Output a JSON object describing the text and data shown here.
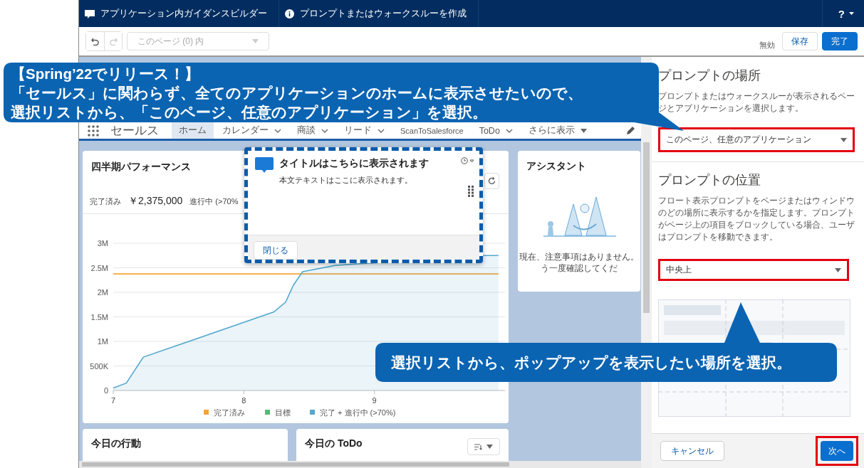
{
  "top_bar": {
    "tabs": [
      {
        "label": "アプリケーション内ガイダンスビルダー"
      },
      {
        "label": "プロンプトまたはウォークスルーを作成"
      }
    ],
    "help": "?"
  },
  "toolbar": {
    "page_select": {
      "value": "このページ (0) 内",
      "disabled": true
    },
    "status": "無効",
    "buttons": [
      {
        "label": "保存",
        "kind": "neutral"
      },
      {
        "label": "完了",
        "kind": "brand"
      }
    ]
  },
  "app_nav": {
    "app_name": "セールス",
    "tabs": [
      {
        "label": "ホーム",
        "selected": true,
        "kind": "tab",
        "menu": false
      },
      {
        "label": "カレンダー",
        "selected": false,
        "kind": "tab",
        "menu": true
      },
      {
        "label": "商談",
        "selected": false,
        "kind": "tab",
        "menu": true
      },
      {
        "label": "リード",
        "selected": false,
        "kind": "tab",
        "menu": true
      },
      {
        "label": "ScanToSalesforce",
        "selected": false,
        "kind": "tab",
        "menu": false
      },
      {
        "label": "ToDo",
        "selected": false,
        "kind": "tab",
        "menu": true
      },
      {
        "label": "さらに表示",
        "selected": false,
        "kind": "more",
        "menu": true
      }
    ]
  },
  "dashboard": {
    "performance": {
      "title": "四半期パフォーマンス",
      "closed_label": "完了済み",
      "closed_value": "￥2,375,000",
      "open_label": "進行中 (>70%",
      "chart_data": {
        "type": "line",
        "grid": true,
        "legend": true,
        "x": [
          7,
          7.1,
          7.23,
          8.23,
          8.32,
          8.38,
          8.45,
          8.7,
          9.85,
          9.95
        ],
        "xlim": [
          7,
          10
        ],
        "ylim": [
          0,
          3000000
        ],
        "xticks": [
          7,
          8,
          9
        ],
        "yticks": [
          {
            "value": 0,
            "label": "0"
          },
          {
            "value": 500000,
            "label": "500K"
          },
          {
            "value": 1000000,
            "label": "1M"
          },
          {
            "value": 1500000,
            "label": "1.5M"
          },
          {
            "value": 2000000,
            "label": "2M"
          },
          {
            "value": 2500000,
            "label": "2.5M"
          },
          {
            "value": 3000000,
            "label": "3M"
          }
        ],
        "series": [
          {
            "name": "完了済み",
            "type": "line",
            "color": "#f4a43a",
            "values": [
              2375000,
              2375000,
              2375000,
              2375000,
              2375000,
              2375000,
              2375000,
              2375000,
              2375000,
              2375000
            ]
          },
          {
            "name": "目標",
            "type": "line",
            "color": "#4bc076",
            "values": [
              null,
              null,
              null,
              null,
              null,
              null,
              null,
              null,
              null,
              null
            ]
          },
          {
            "name": "完了 + 進行中 (>70%)",
            "type": "area",
            "color": "#54a8cf",
            "values": [
              50000,
              150000,
              680000,
              1600000,
              1800000,
              2150000,
              2420000,
              2550000,
              2750000,
              2750000
            ]
          }
        ]
      }
    },
    "assistant": {
      "title": "アシスタント",
      "message_lines": [
        "現在、注意事項はありません。",
        "う一度確認してくだ"
      ]
    },
    "today_cards": [
      {
        "title": "今日の行動",
        "sort_button": false
      },
      {
        "title": "今日の ToDo",
        "sort_button": true
      }
    ]
  },
  "prompt_preview": {
    "title": "タイトルはこちらに表示されます",
    "body": "本文テキストはここに表示されます。",
    "close": "閉じる"
  },
  "panel": {
    "sections": [
      {
        "heading": "プロンプトの場所",
        "description": "プロンプトまたはウォークスルーが表示されるページとアプリケーションを選択します。",
        "value": "このページ、任意のアプリケーション",
        "highlighted": true
      },
      {
        "heading": "プロンプトの位置",
        "description": "フロート表示プロンプトをページまたはウィンドウのどの場所に表示するかを指定します。プロンプトがページ上の項目をブロックしている場合、ユーザはプロンプトを移動できます。",
        "value": "中央上",
        "highlighted": true
      }
    ],
    "cancel": "キャンセル",
    "next": {
      "label": "次へ",
      "highlighted": true
    }
  },
  "callouts": [
    {
      "lines": [
        "【Spring’22でリリース！】",
        "「セールス」に関わらず、全てのアプリケーションのホームに表示させたいので、",
        "選択リストから、「このページ、任意のアプリケーション」を選択。"
      ]
    },
    {
      "lines": [
        "選択リストから、ポップアップを表示したい場所を選択。"
      ]
    }
  ]
}
